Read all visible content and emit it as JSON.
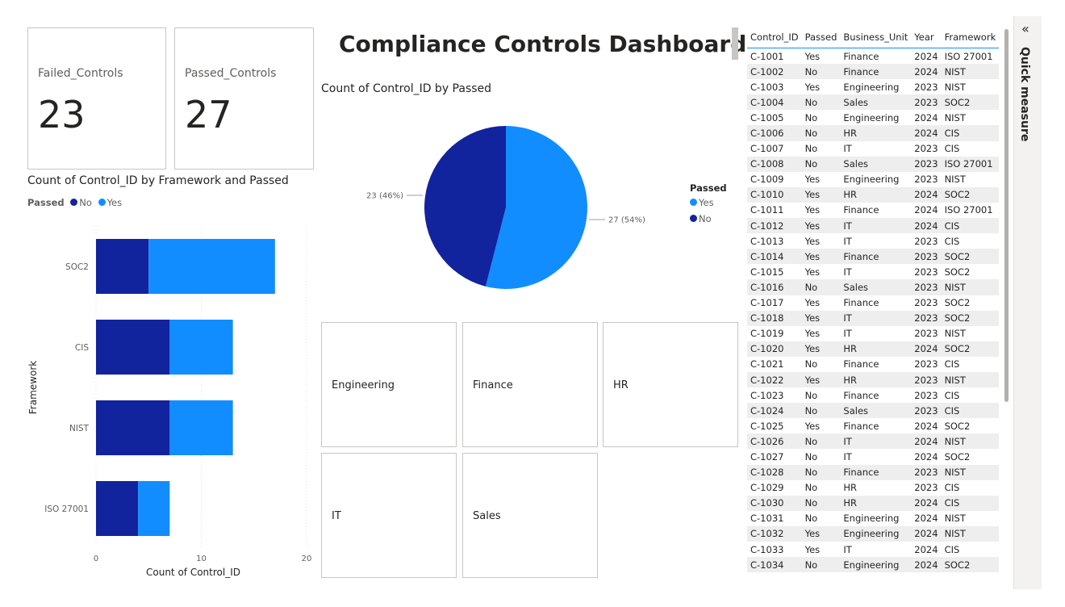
{
  "title": "Compliance Controls Dashboard",
  "cards": [
    {
      "label": "Failed_Controls",
      "value": "23"
    },
    {
      "label": "Passed_Controls",
      "value": "27"
    }
  ],
  "colors": {
    "no": "#12239e",
    "yes": "#118dff",
    "accent": "#118dff"
  },
  "bar_legend": {
    "title": "Passed",
    "items": [
      "No",
      "Yes"
    ]
  },
  "pie_legend": {
    "title": "Passed",
    "items": [
      "Yes",
      "No"
    ]
  },
  "slicer": {
    "items": [
      "Engineering",
      "Finance",
      "HR",
      "IT",
      "Sales"
    ]
  },
  "quick_measure": {
    "label": "Quick measure",
    "chevron": "«"
  },
  "table": {
    "columns": [
      "Control_ID",
      "Passed",
      "Business_Unit",
      "Year",
      "Framework"
    ],
    "rows": [
      [
        "C-1001",
        "Yes",
        "Finance",
        "2024",
        "ISO 27001"
      ],
      [
        "C-1002",
        "No",
        "Finance",
        "2024",
        "NIST"
      ],
      [
        "C-1003",
        "Yes",
        "Engineering",
        "2023",
        "NIST"
      ],
      [
        "C-1004",
        "No",
        "Sales",
        "2023",
        "SOC2"
      ],
      [
        "C-1005",
        "No",
        "Engineering",
        "2024",
        "NIST"
      ],
      [
        "C-1006",
        "No",
        "HR",
        "2024",
        "CIS"
      ],
      [
        "C-1007",
        "No",
        "IT",
        "2023",
        "CIS"
      ],
      [
        "C-1008",
        "No",
        "Sales",
        "2023",
        "ISO 27001"
      ],
      [
        "C-1009",
        "Yes",
        "Engineering",
        "2023",
        "NIST"
      ],
      [
        "C-1010",
        "Yes",
        "HR",
        "2024",
        "SOC2"
      ],
      [
        "C-1011",
        "Yes",
        "Finance",
        "2024",
        "ISO 27001"
      ],
      [
        "C-1012",
        "Yes",
        "IT",
        "2024",
        "CIS"
      ],
      [
        "C-1013",
        "Yes",
        "IT",
        "2023",
        "CIS"
      ],
      [
        "C-1014",
        "Yes",
        "Finance",
        "2023",
        "SOC2"
      ],
      [
        "C-1015",
        "Yes",
        "IT",
        "2023",
        "SOC2"
      ],
      [
        "C-1016",
        "No",
        "Sales",
        "2023",
        "NIST"
      ],
      [
        "C-1017",
        "Yes",
        "Finance",
        "2023",
        "SOC2"
      ],
      [
        "C-1018",
        "Yes",
        "IT",
        "2023",
        "SOC2"
      ],
      [
        "C-1019",
        "Yes",
        "IT",
        "2023",
        "NIST"
      ],
      [
        "C-1020",
        "Yes",
        "HR",
        "2024",
        "SOC2"
      ],
      [
        "C-1021",
        "No",
        "Finance",
        "2023",
        "CIS"
      ],
      [
        "C-1022",
        "Yes",
        "HR",
        "2023",
        "NIST"
      ],
      [
        "C-1023",
        "No",
        "Finance",
        "2023",
        "CIS"
      ],
      [
        "C-1024",
        "No",
        "Sales",
        "2023",
        "CIS"
      ],
      [
        "C-1025",
        "Yes",
        "Finance",
        "2024",
        "SOC2"
      ],
      [
        "C-1026",
        "No",
        "IT",
        "2024",
        "NIST"
      ],
      [
        "C-1027",
        "No",
        "IT",
        "2024",
        "SOC2"
      ],
      [
        "C-1028",
        "No",
        "Finance",
        "2023",
        "NIST"
      ],
      [
        "C-1029",
        "No",
        "HR",
        "2023",
        "CIS"
      ],
      [
        "C-1030",
        "No",
        "HR",
        "2024",
        "CIS"
      ],
      [
        "C-1031",
        "No",
        "Engineering",
        "2024",
        "NIST"
      ],
      [
        "C-1032",
        "Yes",
        "Engineering",
        "2024",
        "NIST"
      ],
      [
        "C-1033",
        "Yes",
        "IT",
        "2024",
        "CIS"
      ],
      [
        "C-1034",
        "No",
        "Engineering",
        "2024",
        "SOC2"
      ]
    ]
  },
  "chart_data": [
    {
      "type": "bar",
      "orientation": "horizontal",
      "stacked": true,
      "title": "Count of Control_ID by Framework and Passed",
      "xlabel": "Count of Control_ID",
      "ylabel": "Framework",
      "categories": [
        "SOC2",
        "CIS",
        "NIST",
        "ISO 27001"
      ],
      "series": [
        {
          "name": "No",
          "values": [
            5,
            7,
            7,
            4
          ]
        },
        {
          "name": "Yes",
          "values": [
            12,
            6,
            6,
            3
          ]
        }
      ],
      "xlim": [
        0,
        20
      ],
      "xticks": [
        "0",
        "10",
        "20"
      ],
      "legend": "top-left"
    },
    {
      "type": "pie",
      "title": "Count of Control_ID by Passed",
      "slices": [
        {
          "name": "Yes",
          "value": 27,
          "label": "27 (54%)"
        },
        {
          "name": "No",
          "value": 23,
          "label": "23 (46%)"
        }
      ],
      "legend": "right"
    }
  ]
}
